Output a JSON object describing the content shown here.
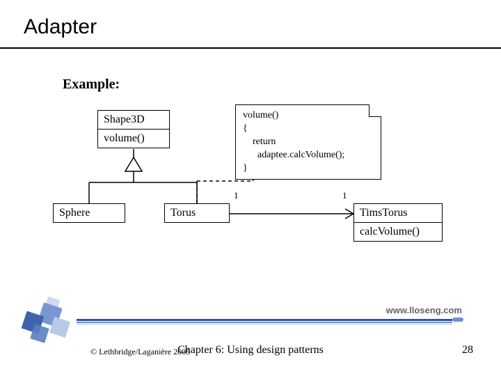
{
  "title": "Adapter",
  "example_label": "Example:",
  "uml": {
    "shape3d": {
      "name": "Shape3D",
      "op": "volume()"
    },
    "sphere": {
      "name": "Sphere"
    },
    "torus": {
      "name": "Torus"
    },
    "timstorus": {
      "name": "TimsTorus",
      "op": "calcVolume()"
    },
    "note_text": "volume()\n{\n    return\n      adaptee.calcVolume();\n}",
    "assoc": {
      "left_mult": "1",
      "right_mult": "1"
    }
  },
  "footer": {
    "url": "www.lloseng.com",
    "copyright": "© Lethbridge/Laganière 2005",
    "chapter": "Chapter 6: Using design patterns",
    "page": "28"
  }
}
